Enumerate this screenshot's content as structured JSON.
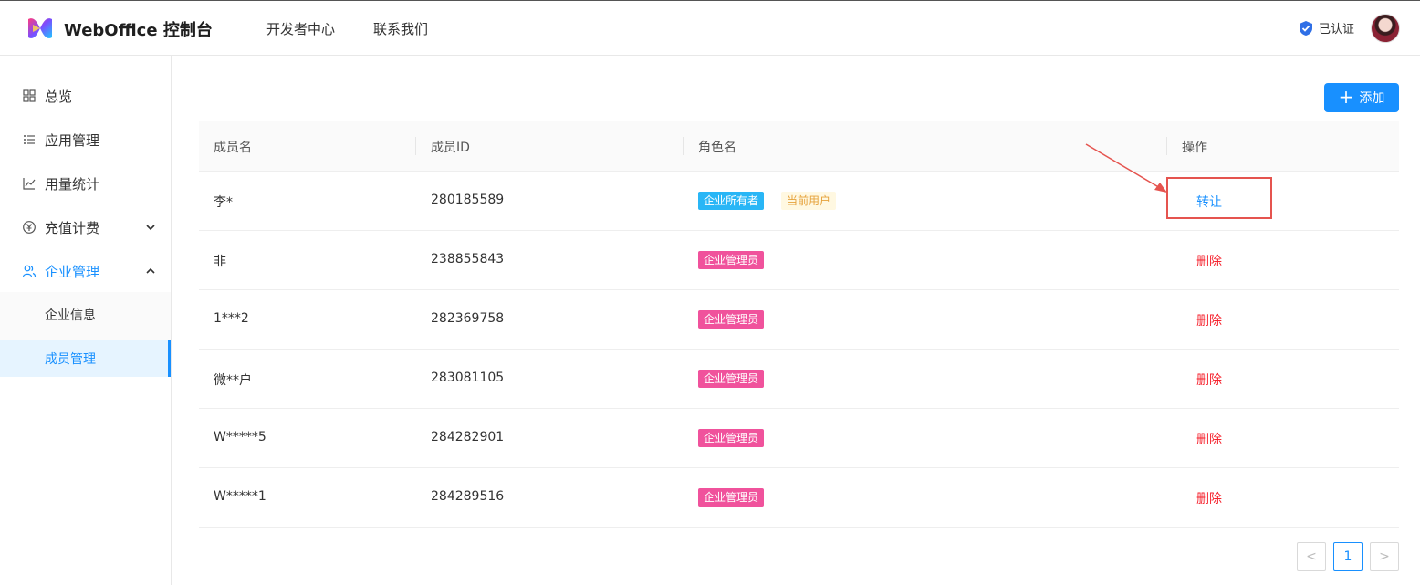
{
  "header": {
    "brand": "WebOffice 控制台",
    "nav": [
      "开发者中心",
      "联系我们"
    ],
    "verified_label": "已认证"
  },
  "sidebar": {
    "items": [
      {
        "label": "总览",
        "icon": "grid-icon"
      },
      {
        "label": "应用管理",
        "icon": "list-icon"
      },
      {
        "label": "用量统计",
        "icon": "chart-icon"
      },
      {
        "label": "充值计费",
        "icon": "yen-icon"
      },
      {
        "label": "企业管理",
        "icon": "users-icon"
      }
    ],
    "subitems": [
      "企业信息",
      "成员管理"
    ]
  },
  "main": {
    "add_button": "添加",
    "columns": [
      "成员名",
      "成员ID",
      "角色名",
      "操作"
    ],
    "rows": [
      {
        "name": "李*",
        "id": "280185589",
        "role": "企业所有者",
        "extra": "当前用户",
        "action": "转让"
      },
      {
        "name": "非",
        "id": "238855843",
        "role": "企业管理员",
        "action": "删除"
      },
      {
        "name": "1***2",
        "id": "282369758",
        "role": "企业管理员",
        "action": "删除"
      },
      {
        "name": "微**户",
        "id": "283081105",
        "role": "企业管理员",
        "action": "删除"
      },
      {
        "name": "W*****5",
        "id": "284282901",
        "role": "企业管理员",
        "action": "删除"
      },
      {
        "name": "W*****1",
        "id": "284289516",
        "role": "企业管理员",
        "action": "删除"
      }
    ],
    "pagination": {
      "prev": "<",
      "page": "1",
      "next": ">"
    }
  },
  "colors": {
    "accent": "#1890ff",
    "owner_tag": "#29b6f6",
    "admin_tag": "#f0529c",
    "delete": "#f5222d",
    "annotation": "#e5544f"
  }
}
